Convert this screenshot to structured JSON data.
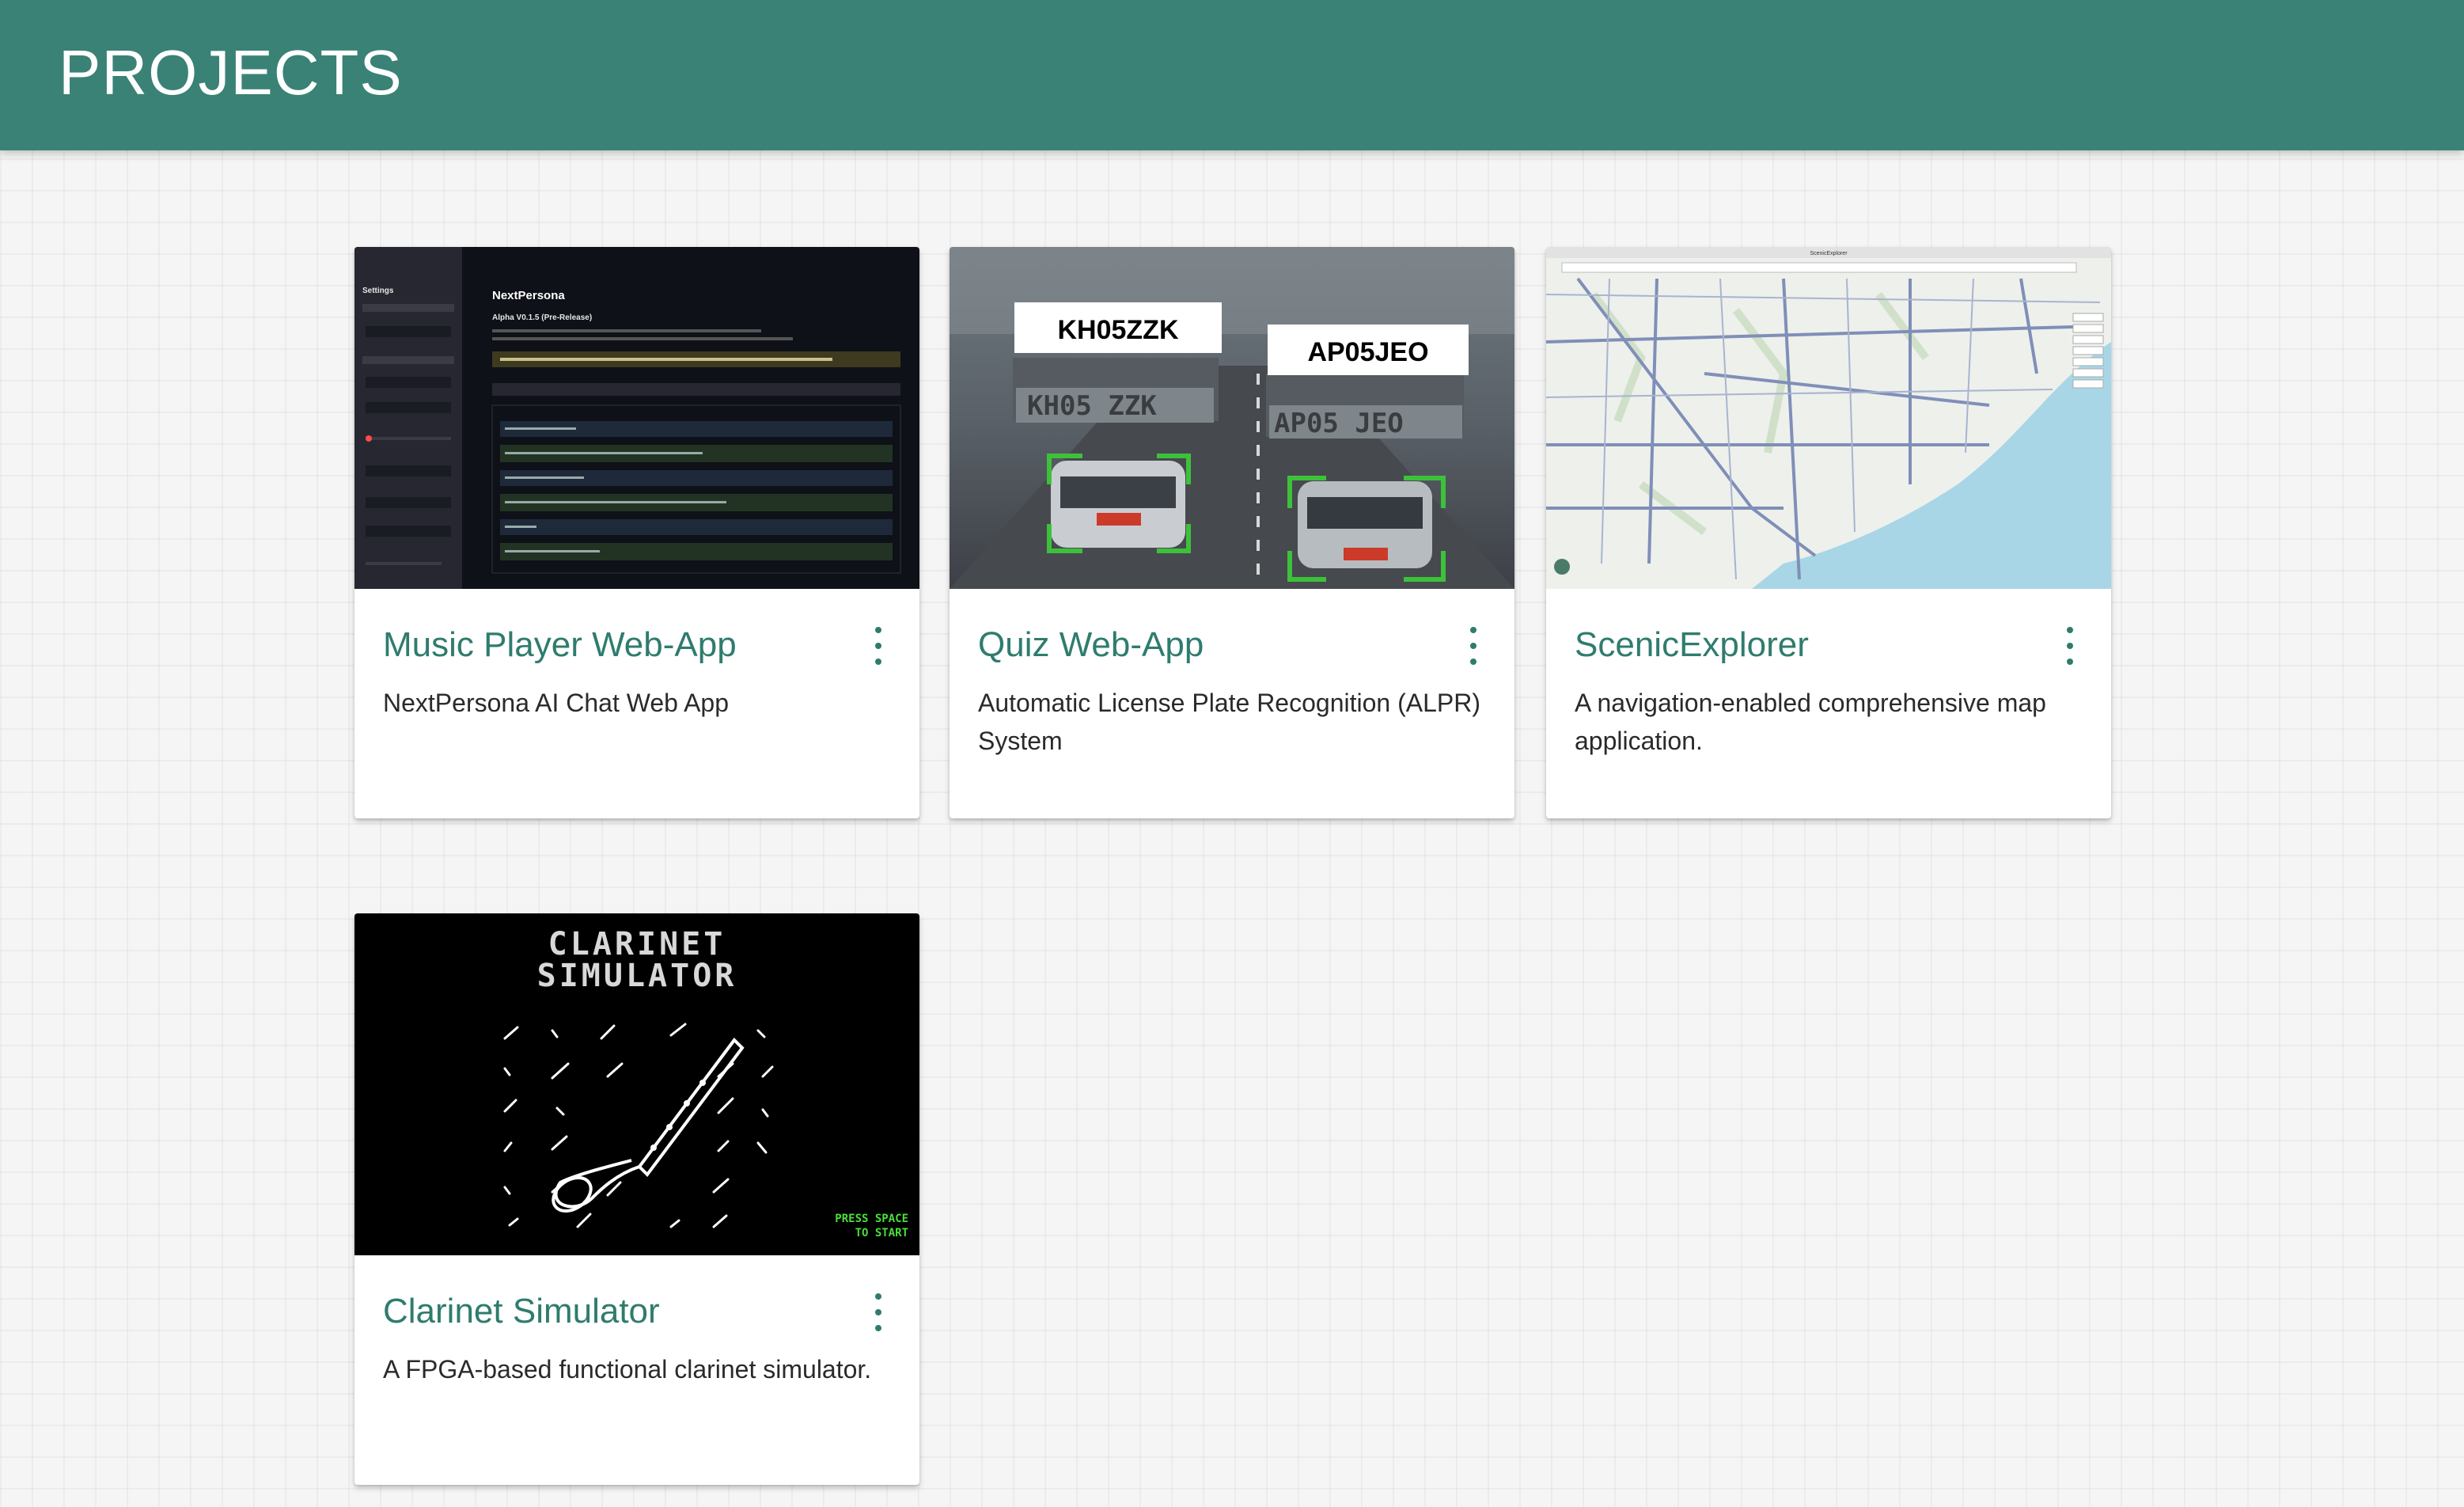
{
  "header": {
    "title": "PROJECTS",
    "color": "#3a8275"
  },
  "cards": [
    {
      "title": "Music Player Web-App",
      "description": "NextPersona AI Chat Web App",
      "menu_icon": "more-vert-icon",
      "image": {
        "app_name": "NextPersona",
        "version": "Alpha V0.1.5 (Pre-Release)",
        "sidebar_title": "Settings"
      }
    },
    {
      "title": "Quiz Web-App",
      "description": "Automatic License Plate Recognition (ALPR) System",
      "menu_icon": "more-vert-icon",
      "image": {
        "plate_1": "KH05ZZK",
        "plate_2": "AP05JEO"
      }
    },
    {
      "title": "ScenicExplorer",
      "description": "A navigation-enabled comprehensive map application.",
      "menu_icon": "more-vert-icon",
      "image": {
        "window_title": "ScenicExplorer"
      }
    },
    {
      "title": "Clarinet Simulator",
      "description": "A FPGA-based functional clarinet simulator.",
      "menu_icon": "more-vert-icon",
      "image": {
        "title_line_1": "CLARINET",
        "title_line_2": "SIMULATOR",
        "prompt_line_1": "PRESS SPACE",
        "prompt_line_2": "TO START"
      }
    }
  ],
  "colors": {
    "accent": "#2f7c6e",
    "background": "#f5f5f5",
    "card": "#ffffff"
  }
}
